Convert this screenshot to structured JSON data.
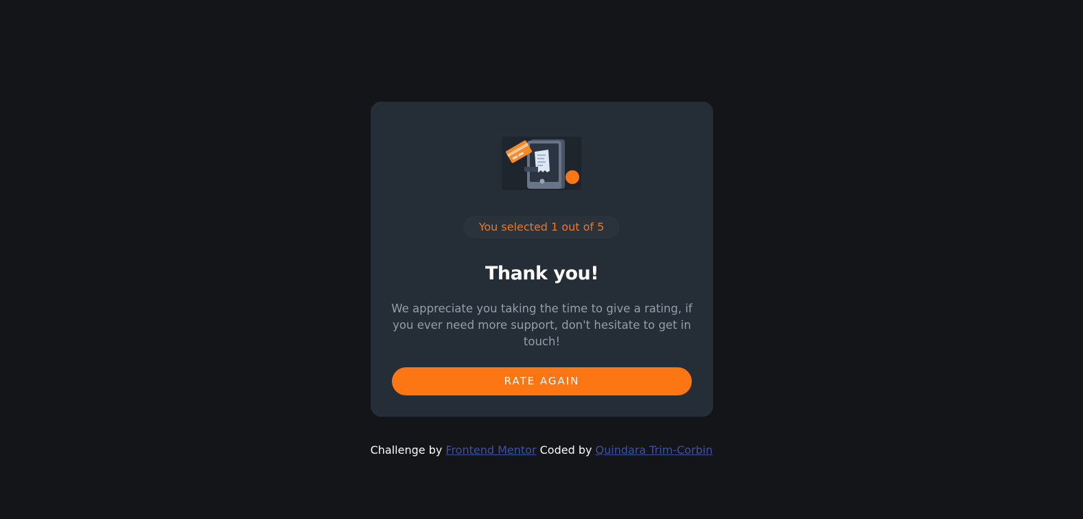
{
  "card": {
    "badge_text": "You selected 1 out of 5",
    "title": "Thank you!",
    "message": "We appreciate you taking the time to give a rating, if you ever need more support, don't hesitate to get in touch!",
    "button_label": "RATE AGAIN"
  },
  "attribution": {
    "challenge_prefix": "Challenge by",
    "challenge_link": "Frontend Mentor",
    "coded_prefix": "Coded by",
    "author_link": "Quindara Trim-Corbin"
  },
  "icons": {
    "illustration": "phone-payment-receipt-illustration"
  },
  "colors": {
    "background": "#131518",
    "card": "#252d37",
    "accent": "#fc7614",
    "text_muted": "#959eac",
    "link": "#3e52a3"
  }
}
